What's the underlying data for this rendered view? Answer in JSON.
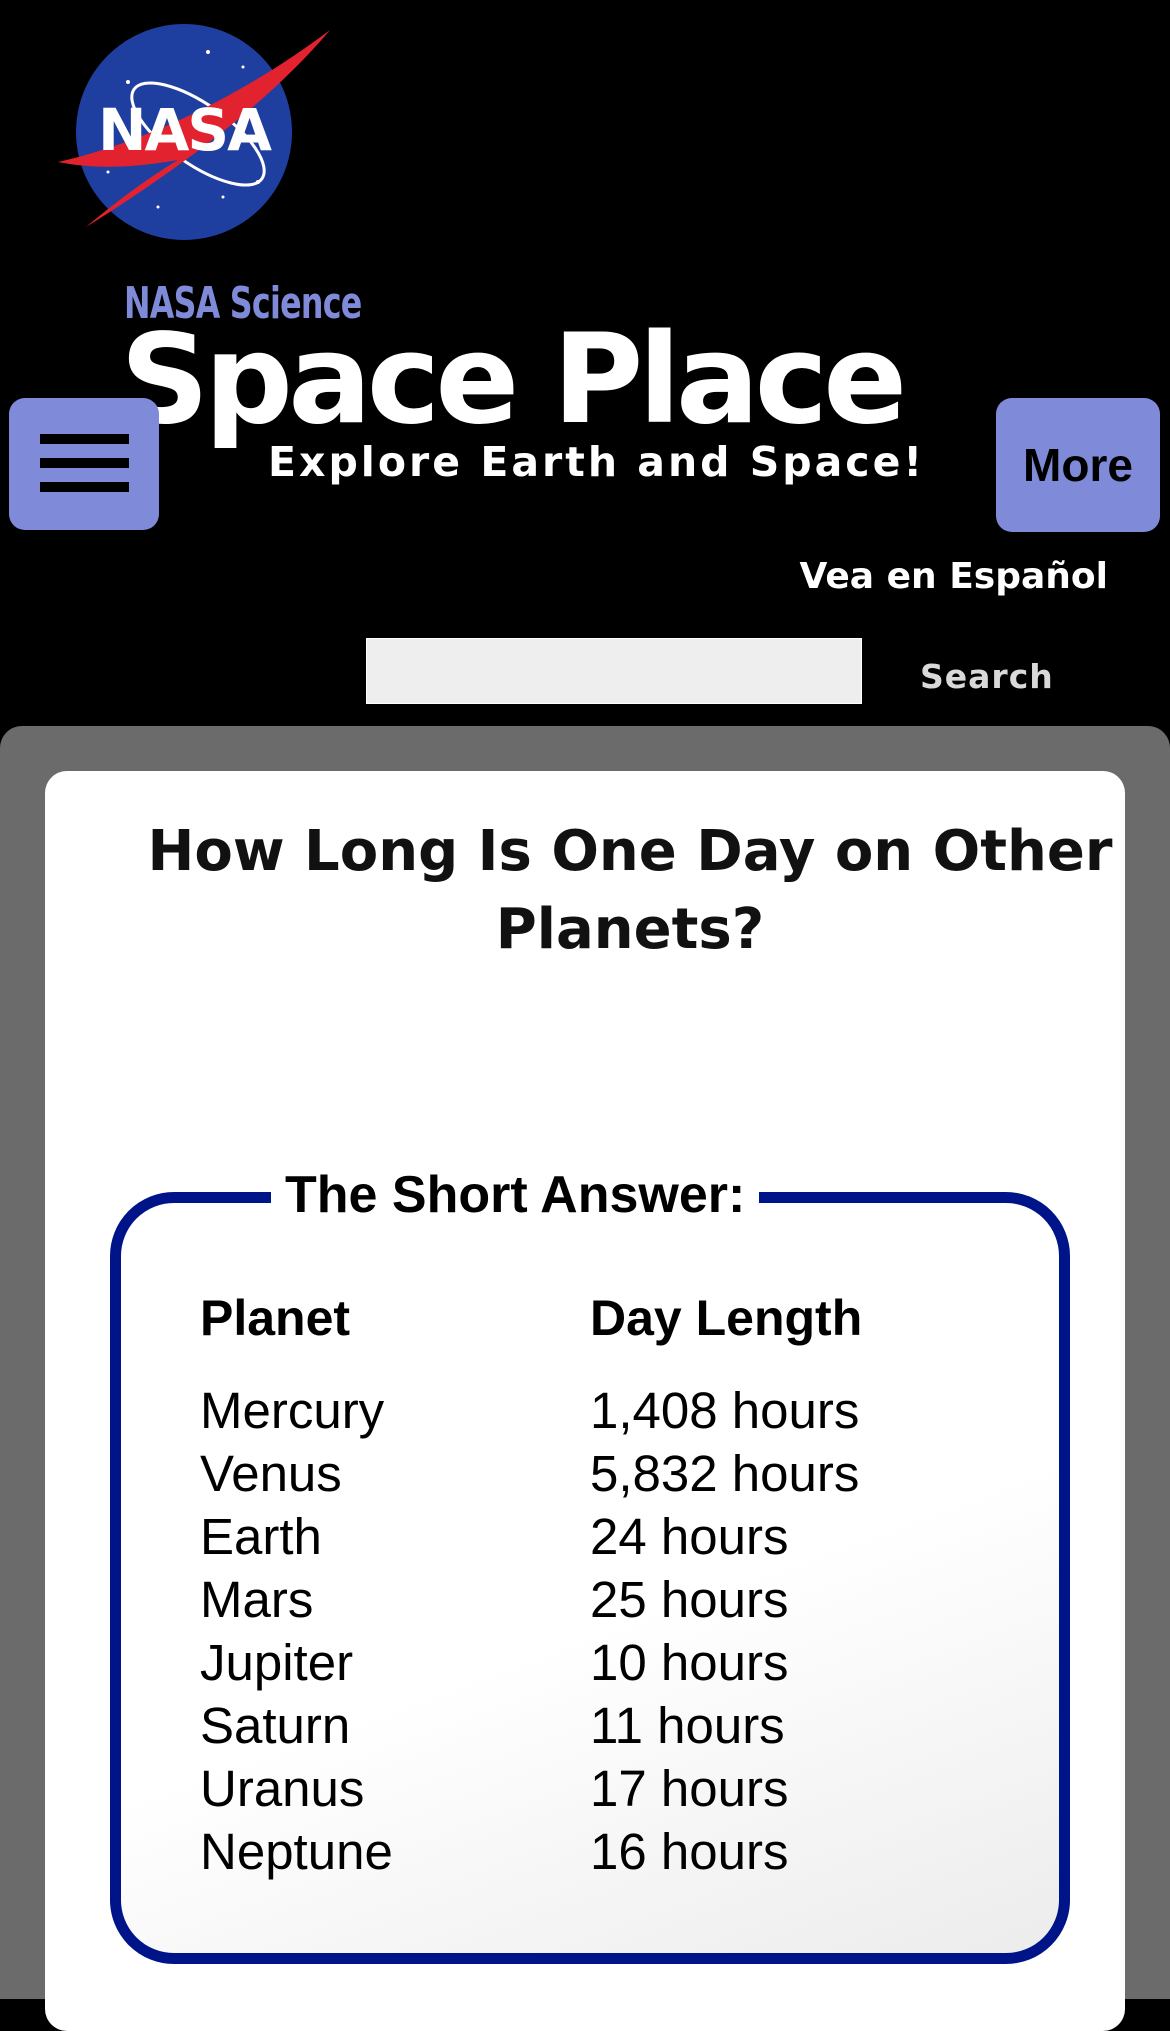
{
  "header": {
    "logo_text": "NASA",
    "nasa_science": "NASA Science",
    "site_title": "Space Place",
    "tagline": "Explore Earth and Space!",
    "more_label": "More",
    "espanol_label": "Vea en Español",
    "search_value": "",
    "search_label": "Search"
  },
  "colors": {
    "accent": "#7f8bd8",
    "box_border": "#00148a",
    "background": "#000000",
    "content_bg": "#6b6b6b"
  },
  "main": {
    "title": "How Long Is One Day on Other Planets?",
    "short_answer": {
      "legend": "The Short Answer:",
      "headers": [
        "Planet",
        "Day Length"
      ],
      "rows": [
        {
          "planet": "Mercury",
          "day": "1,408 hours"
        },
        {
          "planet": "Venus",
          "day": "5,832 hours"
        },
        {
          "planet": "Earth",
          "day": "24 hours"
        },
        {
          "planet": "Mars",
          "day": "25 hours"
        },
        {
          "planet": "Jupiter",
          "day": "10 hours"
        },
        {
          "planet": "Saturn",
          "day": "11 hours"
        },
        {
          "planet": "Uranus",
          "day": "17 hours"
        },
        {
          "planet": "Neptune",
          "day": "16 hours"
        }
      ]
    }
  }
}
